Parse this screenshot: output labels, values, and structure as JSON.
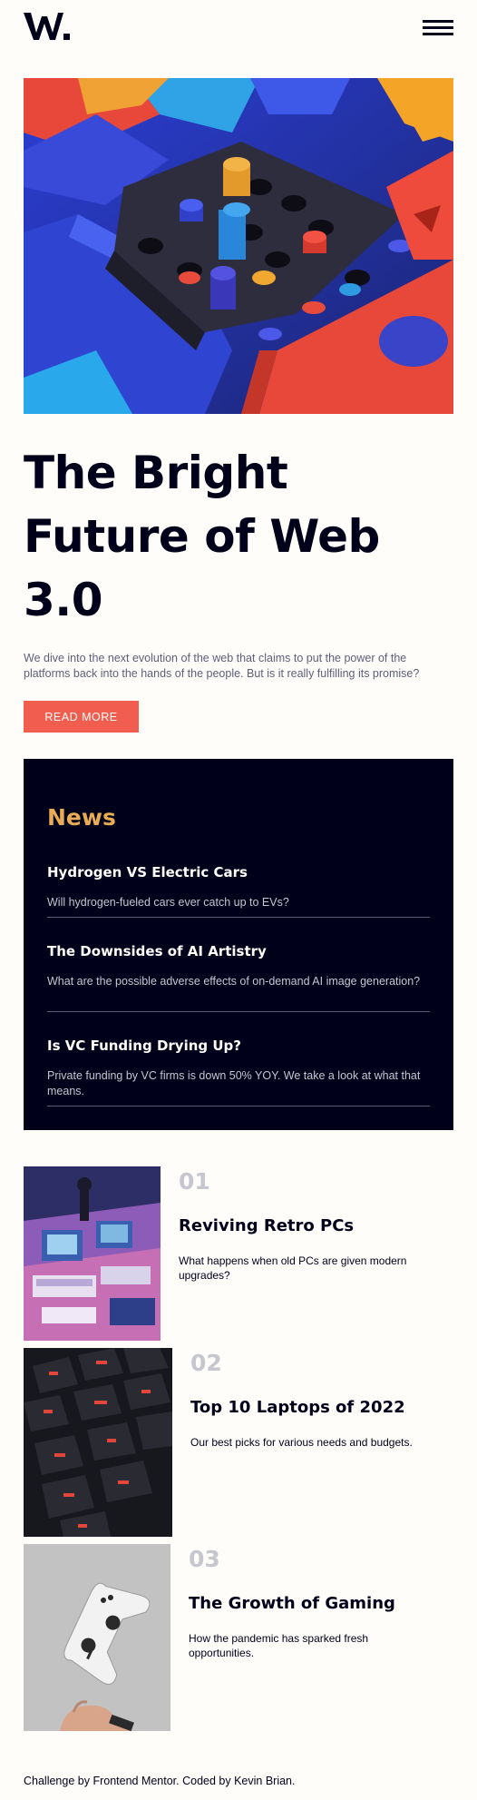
{
  "header": {
    "logo_text": "W.",
    "menu_icon": "hamburger-menu-icon"
  },
  "hero": {
    "image_alt": "abstract colorful 3D blocks",
    "title": "The Bright Future of Web 3.0",
    "intro": "We dive into the next evolution of the web that claims to put the power of the platforms back into the hands of the people. But is it really fulfilling its promise?",
    "button_label": "READ MORE"
  },
  "news": {
    "heading": "News",
    "items": [
      {
        "title": "Hydrogen VS Electric Cars",
        "desc": "Will hydrogen-fueled cars ever catch up to EVs?"
      },
      {
        "title": "The Downsides of AI Artistry",
        "desc": "What are the possible adverse effects of on-demand AI image generation?"
      },
      {
        "title": "Is VC Funding Drying Up?",
        "desc": "Private funding by VC firms is down 50% YOY. We take a look at what that means."
      }
    ]
  },
  "articles": [
    {
      "num": "01",
      "title": "Reviving Retro PCs",
      "desc": "What happens when old PCs are given modern upgrades?"
    },
    {
      "num": "02",
      "title": "Top 10 Laptops of 2022",
      "desc": "Our best picks for various needs and budgets."
    },
    {
      "num": "03",
      "title": "The Growth of Gaming",
      "desc": "How the pandemic has sparked fresh opportunities."
    }
  ],
  "footer": {
    "text": "Challenge by Frontend Mentor. Coded by Kevin Brian."
  },
  "colors": {
    "accent": "#f15e50",
    "news_bg": "#00001a",
    "news_heading": "#e9ab53",
    "muted": "#5d5f79"
  }
}
